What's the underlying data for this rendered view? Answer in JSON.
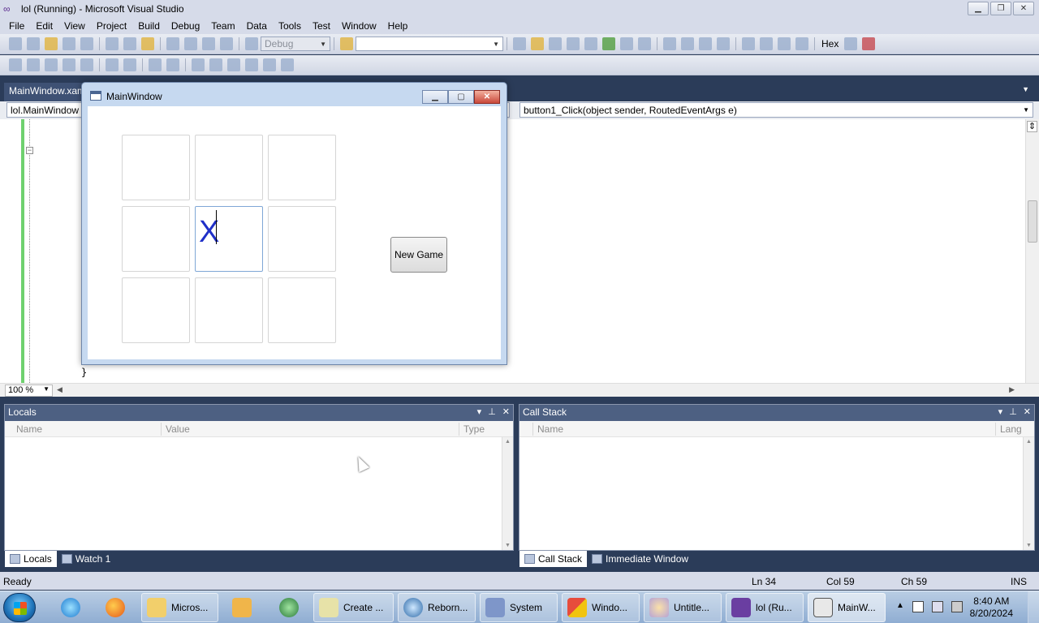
{
  "vs": {
    "title": "lol (Running) - Microsoft Visual Studio",
    "menu": [
      "File",
      "Edit",
      "View",
      "Project",
      "Build",
      "Debug",
      "Team",
      "Data",
      "Tools",
      "Test",
      "Window",
      "Help"
    ],
    "toolbar": {
      "config": "Debug",
      "search_value": "",
      "hex_label": "Hex"
    },
    "doc_tab": "MainWindow.xaml",
    "nav_left": "lol.MainWindow",
    "nav_right": "button1_Click(object sender, RoutedEventArgs e)",
    "code_brace": "}",
    "zoom": "100 %"
  },
  "wpf": {
    "title": "MainWindow",
    "board": [
      "",
      "",
      "",
      "",
      "X",
      "",
      "",
      "",
      ""
    ],
    "new_game_label": "New Game"
  },
  "locals": {
    "title": "Locals",
    "columns": [
      "Name",
      "Value",
      "Type"
    ],
    "tabs": [
      "Locals",
      "Watch 1"
    ]
  },
  "callstack": {
    "title": "Call Stack",
    "columns": [
      "Name",
      "Lang"
    ],
    "tabs": [
      "Call Stack",
      "Immediate Window"
    ]
  },
  "status": {
    "ready": "Ready",
    "ln": "Ln 34",
    "col": "Col 59",
    "ch": "Ch 59",
    "ins": "INS"
  },
  "taskbar": {
    "items": [
      "Micros...",
      "Create ...",
      "Reborn...",
      "System",
      "Windo...",
      "Untitle...",
      "lol (Ru...",
      "MainW..."
    ],
    "time": "8:40 AM",
    "date": "8/20/2024"
  }
}
